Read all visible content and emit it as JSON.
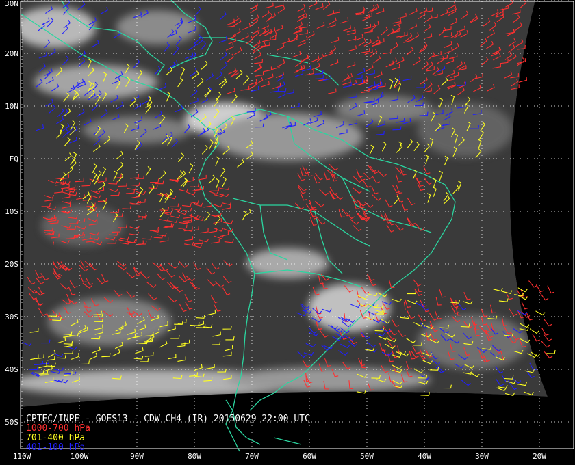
{
  "map": {
    "lat_labels": [
      "30N",
      "20N",
      "10N",
      "EQ",
      "10S",
      "20S",
      "30S",
      "40S",
      "50S"
    ],
    "lon_labels": [
      "110W",
      "100W",
      "90W",
      "80W",
      "70W",
      "60W",
      "50W",
      "40W",
      "30W",
      "20W"
    ],
    "lat_values": [
      30,
      20,
      10,
      0,
      -10,
      -20,
      -30,
      -40,
      -50
    ],
    "lon_values": [
      -110,
      -100,
      -90,
      -80,
      -70,
      -60,
      -50,
      -40,
      -30,
      -20
    ],
    "colors": {
      "background": "#000000",
      "frame": "#ffffff",
      "grid": "#ffffff",
      "coastline": "#2bd6a0",
      "ir_dark": "#3a3a3a",
      "low_level": "#ff3030",
      "mid_level": "#ffff20",
      "high_level": "#2020ff"
    }
  },
  "caption": {
    "title": "CPTEC/INPE - GOES13 - CDW CH4 (IR) 20150629 22:00 UTC",
    "legend": [
      {
        "label": "1000-700 hPa",
        "color": "#ff3030"
      },
      {
        "label": "701-400 hPa",
        "color": "#ffff20"
      },
      {
        "label": "401-100 hPa",
        "color": "#2020ff"
      }
    ]
  }
}
